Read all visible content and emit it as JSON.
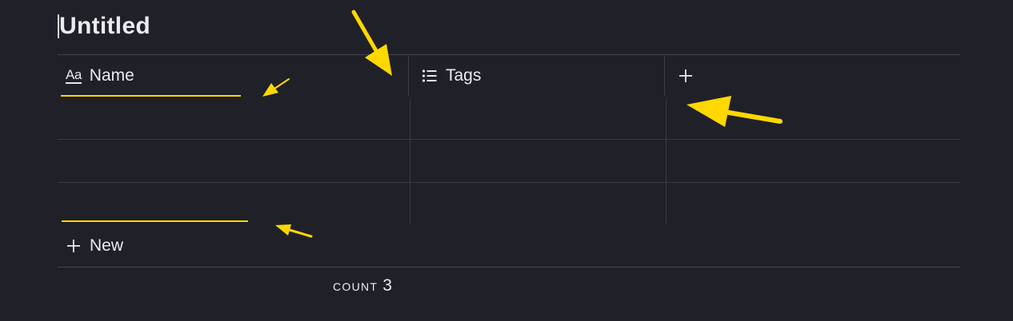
{
  "page": {
    "title": "Untitled"
  },
  "table": {
    "columns": [
      {
        "label": "Name",
        "icon": "text-property-icon"
      },
      {
        "label": "Tags",
        "icon": "list-icon"
      }
    ],
    "add_column_icon": "plus-icon",
    "rows": [
      {
        "name": "",
        "tags": ""
      },
      {
        "name": "",
        "tags": ""
      },
      {
        "name": "",
        "tags": ""
      }
    ],
    "new_row_label": "New",
    "new_row_icon": "plus-icon"
  },
  "footer": {
    "count_label": "COUNT",
    "count_value": "3"
  },
  "annotations": {
    "color": "#ffd800"
  },
  "theme": {
    "background": "#202029",
    "text": "#ececf0",
    "gridline": "#45454f"
  }
}
